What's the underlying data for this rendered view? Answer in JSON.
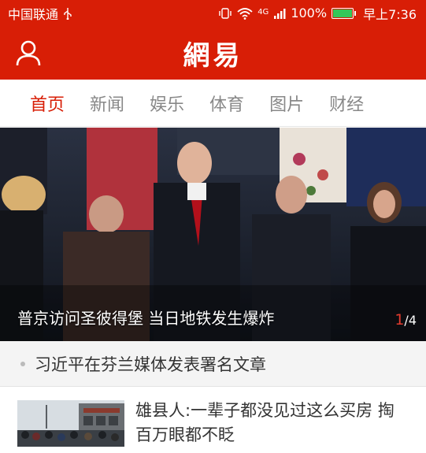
{
  "status_bar": {
    "carrier": "中国联通",
    "usb_icon": "usb-icon",
    "network": "4G",
    "battery": "100%",
    "battery_level": 1.0,
    "time": "早上7:36"
  },
  "header": {
    "logo": "網易",
    "profile_icon": "user-icon"
  },
  "tabs": [
    {
      "label": "首页",
      "active": true
    },
    {
      "label": "新闻",
      "active": false
    },
    {
      "label": "娱乐",
      "active": false
    },
    {
      "label": "体育",
      "active": false
    },
    {
      "label": "图片",
      "active": false
    },
    {
      "label": "财经",
      "active": false
    }
  ],
  "hero": {
    "caption": "普京访问圣彼得堡 当日地铁发生爆炸",
    "pager_current": "1",
    "pager_total": "/4"
  },
  "headline": {
    "text": "习近平在芬兰媒体发表署名文章"
  },
  "news_item": {
    "title": "雄县人:一辈子都没见过这么买房 掏百万眼都不眨"
  },
  "colors": {
    "brand_red": "#d81e06",
    "tab_active": "#d81e06",
    "tab_inactive": "#888888",
    "battery_green": "#34c759"
  }
}
